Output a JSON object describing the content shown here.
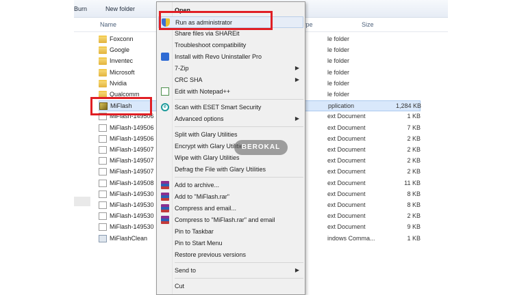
{
  "toolbar": {
    "burn": "Burn",
    "new_folder": "New folder"
  },
  "columns": {
    "name": "Name",
    "type": "ype",
    "size": "Size"
  },
  "files": [
    {
      "name": "Foxconn",
      "type": "le folder",
      "size": "",
      "icon": "folder-icon"
    },
    {
      "name": "Google",
      "type": "le folder",
      "size": "",
      "icon": "folder-icon"
    },
    {
      "name": "Inventec",
      "type": "le folder",
      "size": "",
      "icon": "folder-icon"
    },
    {
      "name": "Microsoft",
      "type": "le folder",
      "size": "",
      "icon": "folder-icon"
    },
    {
      "name": "Nvidia",
      "type": "le folder",
      "size": "",
      "icon": "folder-icon"
    },
    {
      "name": "Qualcomm",
      "type": "le folder",
      "size": "",
      "icon": "folder-icon"
    },
    {
      "name": "MiFlash",
      "type": "pplication",
      "size": "1,284 KB",
      "icon": "application-icon",
      "selected": true
    },
    {
      "name": "MiFlash-149506",
      "type": "ext Document",
      "size": "1 KB",
      "icon": "text-document-icon"
    },
    {
      "name": "MiFlash-149506",
      "type": "ext Document",
      "size": "7 KB",
      "icon": "text-document-icon"
    },
    {
      "name": "MiFlash-149506",
      "type": "ext Document",
      "size": "2 KB",
      "icon": "text-document-icon"
    },
    {
      "name": "MiFlash-149507",
      "type": "ext Document",
      "size": "2 KB",
      "icon": "text-document-icon"
    },
    {
      "name": "MiFlash-149507",
      "type": "ext Document",
      "size": "2 KB",
      "icon": "text-document-icon"
    },
    {
      "name": "MiFlash-149507",
      "type": "ext Document",
      "size": "2 KB",
      "icon": "text-document-icon"
    },
    {
      "name": "MiFlash-149508",
      "type": "ext Document",
      "size": "11 KB",
      "icon": "text-document-icon"
    },
    {
      "name": "MiFlash-149530",
      "type": "ext Document",
      "size": "8 KB",
      "icon": "text-document-icon"
    },
    {
      "name": "MiFlash-149530",
      "type": "ext Document",
      "size": "8 KB",
      "icon": "text-document-icon"
    },
    {
      "name": "MiFlash-149530",
      "type": "ext Document",
      "size": "2 KB",
      "icon": "text-document-icon"
    },
    {
      "name": "MiFlash-149530",
      "type": "ext Document",
      "size": "9 KB",
      "icon": "text-document-icon"
    },
    {
      "name": "MiFlashClean",
      "type": "indows Comma...",
      "size": "1 KB",
      "icon": "windows-command-icon"
    }
  ],
  "menu": {
    "open": "Open",
    "run_as_admin": "Run as administrator",
    "share_shareit": "Share files via SHAREit",
    "troubleshoot": "Troubleshoot compatibility",
    "revo": "Install with Revo Uninstaller Pro",
    "zip": "7-Zip",
    "crc": "CRC SHA",
    "notepad": "Edit with Notepad++",
    "eset": "Scan with ESET Smart Security",
    "advanced": "Advanced options",
    "glary_split": "Split with Glary Utilities",
    "glary_encrypt": "Encrypt with Glary Utilities",
    "glary_wipe": "Wipe with Glary Utilities",
    "glary_defrag": "Defrag the File with Glary Utilities",
    "add_archive": "Add to archive...",
    "add_rar": "Add to \"MiFlash.rar\"",
    "compress_email": "Compress and email...",
    "compress_rar_email": "Compress to \"MiFlash.rar\" and email",
    "pin_taskbar": "Pin to Taskbar",
    "pin_start": "Pin to Start Menu",
    "restore": "Restore previous versions",
    "send_to": "Send to",
    "cut": "Cut",
    "submenu_arrow": "▶",
    "eset_glyph": "e"
  },
  "watermark": "BEROKAL",
  "colors": {
    "highlight": "#e01e24",
    "selection": "#d9e8fb"
  }
}
